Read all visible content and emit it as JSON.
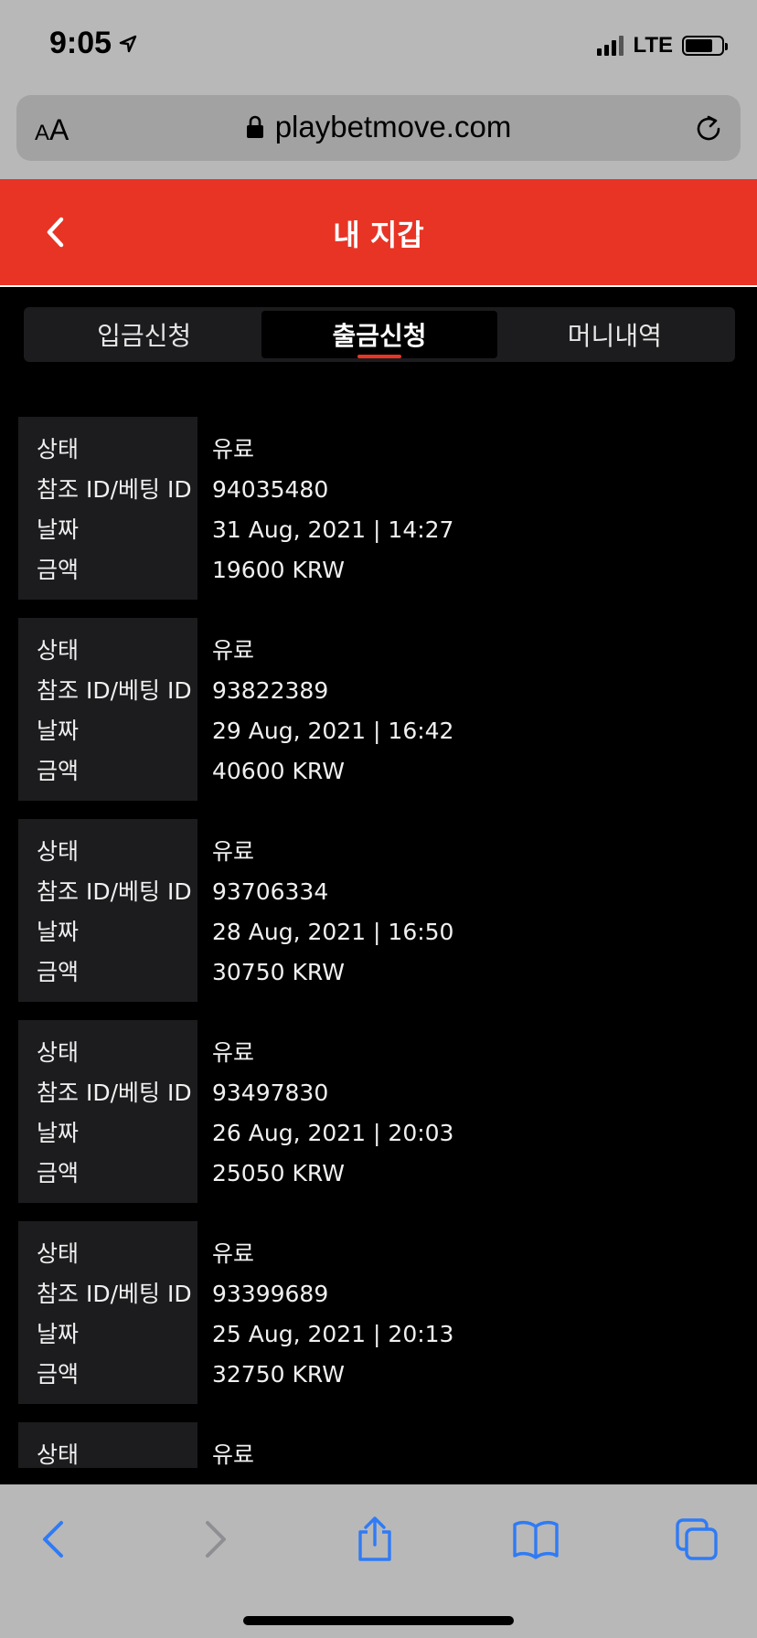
{
  "status_bar": {
    "time": "9:05",
    "network": "LTE"
  },
  "browser": {
    "aa_small": "A",
    "aa_large": "A",
    "url": "playbetmove.com"
  },
  "header": {
    "title": "내 지갑"
  },
  "tabs": [
    {
      "label": "입금신청",
      "active": false
    },
    {
      "label": "출금신청",
      "active": true
    },
    {
      "label": "머니내역",
      "active": false
    }
  ],
  "labels": {
    "status": "상태",
    "ref_id": "참조 ID/베팅 ID",
    "date": "날짜",
    "amount": "금액"
  },
  "records": [
    {
      "status": "유료",
      "ref_id": "94035480",
      "date": "31 Aug, 2021 | 14:27",
      "amount": "19600 KRW"
    },
    {
      "status": "유료",
      "ref_id": "93822389",
      "date": "29 Aug, 2021 | 16:42",
      "amount": "40600 KRW"
    },
    {
      "status": "유료",
      "ref_id": "93706334",
      "date": "28 Aug, 2021 | 16:50",
      "amount": "30750 KRW"
    },
    {
      "status": "유료",
      "ref_id": "93497830",
      "date": "26 Aug, 2021 | 20:03",
      "amount": "25050 KRW"
    },
    {
      "status": "유료",
      "ref_id": "93399689",
      "date": "25 Aug, 2021 | 20:13",
      "amount": "32750 KRW"
    },
    {
      "status": "유료",
      "ref_id": "",
      "date": "",
      "amount": ""
    }
  ],
  "colors": {
    "accent": "#e83425",
    "ios_blue": "#2f7bf5"
  }
}
